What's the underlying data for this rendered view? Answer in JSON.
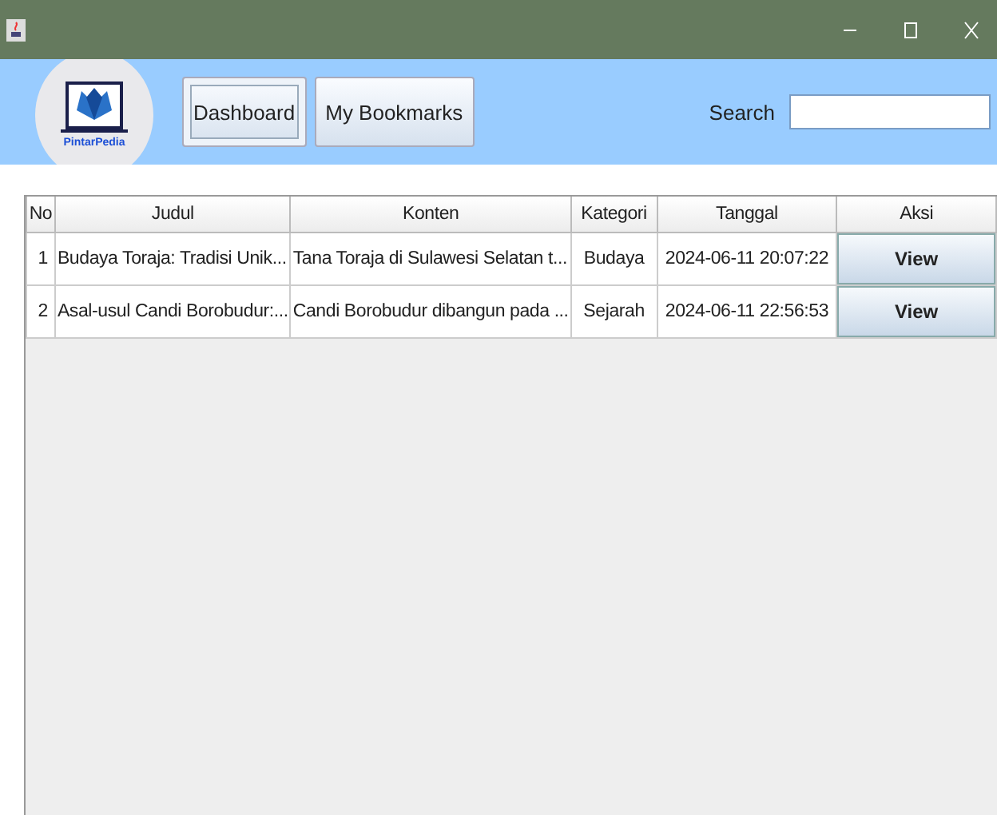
{
  "logo": {
    "text": "PintarPedia"
  },
  "nav": [
    {
      "label": "Dashboard",
      "selected": true
    },
    {
      "label": "My Bookmarks",
      "selected": false
    }
  ],
  "search": {
    "label": "Search"
  },
  "table": {
    "columns": [
      "No",
      "Judul",
      "Konten",
      "Kategori",
      "Tanggal",
      "Aksi"
    ],
    "rows": [
      {
        "no": "1",
        "judul": "Budaya Toraja: Tradisi Unik...",
        "konten": "Tana Toraja di Sulawesi Selatan t...",
        "kategori": "Budaya",
        "tanggal": "2024-06-11 20:07:22",
        "aksi": "View"
      },
      {
        "no": "2",
        "judul": "Asal-usul Candi Borobudur:...",
        "konten": "Candi Borobudur dibangun pada ...",
        "kategori": "Sejarah",
        "tanggal": "2024-06-11 22:56:53",
        "aksi": "View"
      }
    ]
  }
}
